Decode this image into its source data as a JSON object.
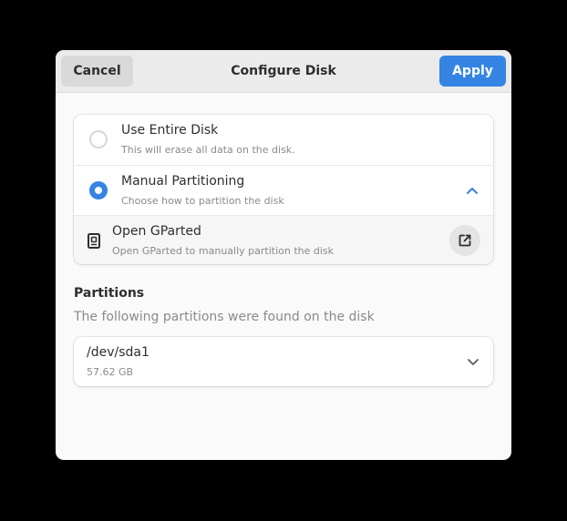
{
  "header": {
    "title": "Configure Disk",
    "cancel_label": "Cancel",
    "apply_label": "Apply"
  },
  "options": [
    {
      "title": "Use Entire Disk",
      "subtitle": "This will erase all data on the disk.",
      "selected": false
    },
    {
      "title": "Manual Partitioning",
      "subtitle": "Choose how to partition the disk",
      "selected": true,
      "expanded": true
    }
  ],
  "gparted": {
    "title": "Open GParted",
    "subtitle": "Open GParted to manually partition the disk",
    "icon": "document-icon",
    "action_icon": "external-link-icon"
  },
  "partitions": {
    "title": "Partitions",
    "description": "The following partitions were found on the disk",
    "items": [
      {
        "name": "/dev/sda1",
        "size": "57.62 GB"
      }
    ]
  },
  "colors": {
    "accent": "#3584e4",
    "window_bg": "#fafafa",
    "header_bg": "#ebebeb"
  }
}
